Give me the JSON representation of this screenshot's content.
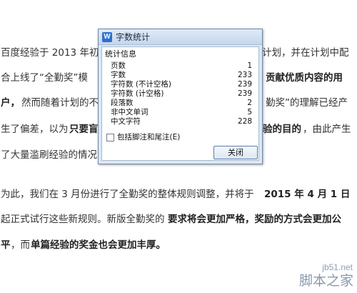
{
  "document": {
    "p1": {
      "line1_a": "百度经验于 2013 年初",
      "line1_b": "计划，并在计划中配",
      "line2_a": "合上线了“全勤奖”模",
      "line2_b": "贡献优质内容的用",
      "line3_a": "户，",
      "line3_b": "然而随着计划的不",
      "line3_c": "勤奖”的理解已经产",
      "line4_a": "生了偏差，以为",
      "line4_b": "只要盲",
      "line4_c": "验的目的",
      "line4_d": "，由此产生",
      "line5_a": "了大量滥刷经验的情况"
    },
    "p2": {
      "line1_a": "为此，我们在 3 月份进行了全勤奖的整体规则调整，并将于 ",
      "line1_b": "2015 年 4 月 1 日",
      "line2_a": "起正式试行这些新规则。新版全勤奖的",
      "line2_b": "要求将会更加严格，奖励的方式会更加公",
      "line3_a": "平",
      "line3_b": "，而",
      "line3_c": "单篇经验的奖金也会更加丰厚。"
    }
  },
  "dialog": {
    "icon_letter": "W",
    "title": "字数统计",
    "group_label": "统计信息",
    "stats": [
      {
        "label": "页数",
        "value": "1"
      },
      {
        "label": "字数",
        "value": "233"
      },
      {
        "label": "字符数 (不计空格)",
        "value": "239"
      },
      {
        "label": "字符数 (计空格)",
        "value": "239"
      },
      {
        "label": "段落数",
        "value": "2"
      },
      {
        "label": "非中文单词",
        "value": "5"
      },
      {
        "label": "中文字符",
        "value": "228"
      }
    ],
    "checkbox_label": "包括脚注和尾注(E)",
    "close_label": "关闭"
  },
  "watermark": {
    "site": "jb51.net",
    "name": "脚本之家"
  }
}
